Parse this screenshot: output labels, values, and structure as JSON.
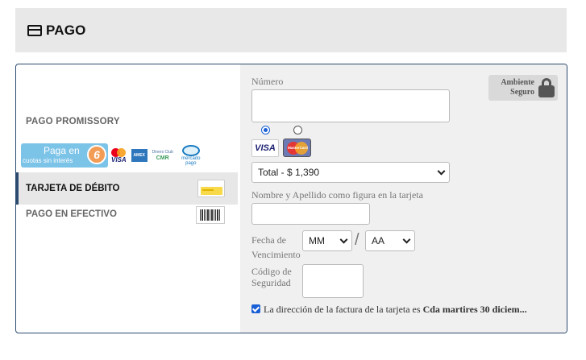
{
  "header": {
    "title": "PAGO",
    "icon": "credit-card-icon"
  },
  "left": {
    "promissory_label": "PAGO PROMISSORY",
    "promo": {
      "line1": "Paga en",
      "line2": "cuotas sin interés",
      "number": "6"
    },
    "logos": {
      "visa_small": "VISA",
      "mercadopago": "mercado pago",
      "cmr": "CMR",
      "diners": "Diners Club"
    },
    "debit_label": "TARJETA DE DÉBITO",
    "cash_label": "PAGO EN EFECTIVO"
  },
  "form": {
    "secure_badge": "Ambiente Seguro",
    "number_label": "Número",
    "number_value": "",
    "card_brands": [
      "VISA",
      "MasterCard"
    ],
    "selected_brand_index": 0,
    "installments_value": "Total - $ 1,390",
    "name_label": "Nombre y Apellido como figura en la tarjeta",
    "name_value": "",
    "expiry_label": "Fecha de Vencimiento",
    "expiry_month_value": "MM",
    "expiry_year_value": "AA",
    "expiry_separator": "/",
    "cvv_label": "Código de Seguridad",
    "cvv_value": "",
    "billing_checked": true,
    "billing_text": "La dirección de la factura de la tarjeta es",
    "billing_address": "Cda martires 30 diciem..."
  }
}
